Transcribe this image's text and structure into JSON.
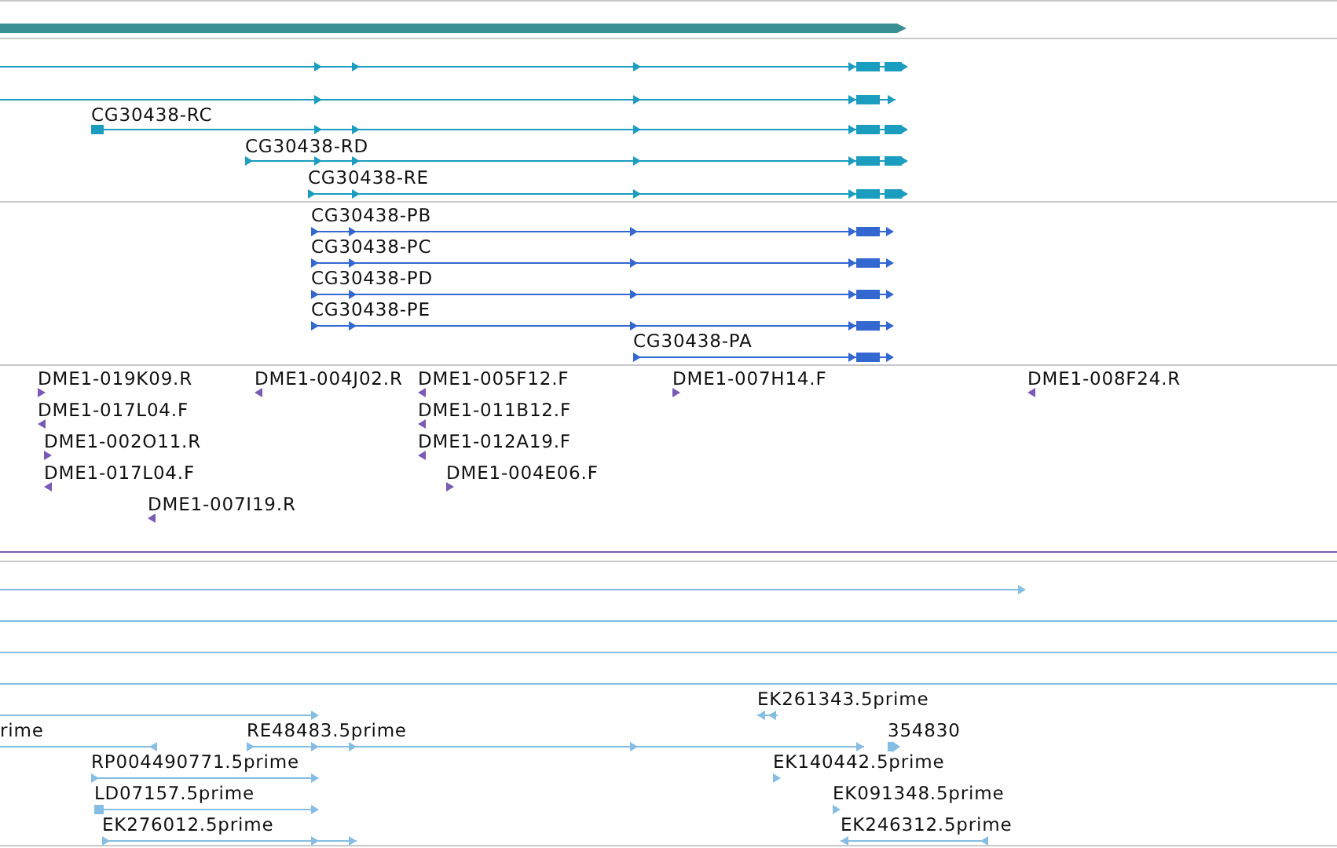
{
  "transcripts": [
    {
      "label": "CG30438-RC"
    },
    {
      "label": "CG30438-RD"
    },
    {
      "label": "CG30438-RE"
    }
  ],
  "proteins": [
    {
      "label": "CG30438-PB"
    },
    {
      "label": "CG30438-PC"
    },
    {
      "label": "CG30438-PD"
    },
    {
      "label": "CG30438-PE"
    },
    {
      "label": "CG30438-PA"
    }
  ],
  "probes": [
    {
      "label": "DME1-019K09.R",
      "reverse": false
    },
    {
      "label": "DME1-017L04.F",
      "reverse": true
    },
    {
      "label": "DME1-002O11.R",
      "reverse": false
    },
    {
      "label": "DME1-017L04.F",
      "reverse": true
    },
    {
      "label": "DME1-007I19.R",
      "reverse": true
    },
    {
      "label": "DME1-004J02.R",
      "reverse": true
    },
    {
      "label": "DME1-005F12.F",
      "reverse": true
    },
    {
      "label": "DME1-011B12.F",
      "reverse": true
    },
    {
      "label": "DME1-012A19.F",
      "reverse": true
    },
    {
      "label": "DME1-004E06.F",
      "reverse": false
    },
    {
      "label": "DME1-007H14.F",
      "reverse": false
    },
    {
      "label": "DME1-008F24.R",
      "reverse": true
    }
  ],
  "cdna": [
    {
      "label": "rime"
    },
    {
      "label": "RE48483.5prime"
    },
    {
      "label": "EK261343.5prime"
    },
    {
      "label": "354830"
    },
    {
      "label": "RP004490771.5prime"
    },
    {
      "label": "EK140442.5prime"
    },
    {
      "label": "LD07157.5prime"
    },
    {
      "label": "EK091348.5prime"
    },
    {
      "label": "EK276012.5prime"
    },
    {
      "label": "EK246312.5prime"
    }
  ]
}
